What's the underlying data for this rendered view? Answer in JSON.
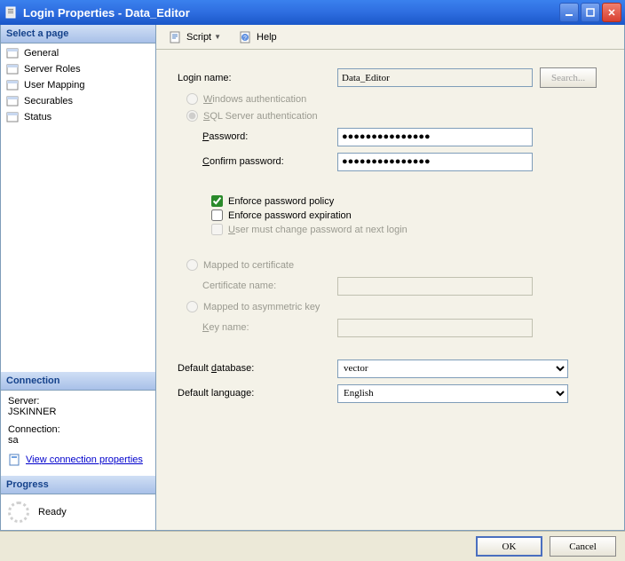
{
  "titlebar": {
    "title": "Login Properties - Data_Editor"
  },
  "sidebar": {
    "select_header": "Select a page",
    "pages": [
      {
        "label": "General"
      },
      {
        "label": "Server Roles"
      },
      {
        "label": "User Mapping"
      },
      {
        "label": "Securables"
      },
      {
        "label": "Status"
      }
    ],
    "connection_header": "Connection",
    "server_label": "Server:",
    "server_value": "JSKINNER",
    "connection_label": "Connection:",
    "connection_value": "sa",
    "view_conn_link": "View connection properties",
    "progress_header": "Progress",
    "progress_status": "Ready"
  },
  "toolbar": {
    "script": "Script",
    "help": "Help"
  },
  "form": {
    "login_name_label": "Login name:",
    "login_name_value": "Data_Editor",
    "search_btn": "Search...",
    "windows_auth": "Windows authentication",
    "sql_auth": "SQL Server authentication",
    "password_label": "Password:",
    "password_value": "●●●●●●●●●●●●●●●",
    "confirm_label": "Confirm password:",
    "confirm_value": "●●●●●●●●●●●●●●●",
    "enforce_policy": "Enforce password policy",
    "enforce_expiration": "Enforce password expiration",
    "must_change": "User must change password at next login",
    "mapped_cert": "Mapped to certificate",
    "cert_name_label": "Certificate name:",
    "mapped_asym": "Mapped to asymmetric key",
    "key_name_label": "Key name:",
    "default_db_label": "Default database:",
    "default_db_value": "vector",
    "default_lang_label": "Default language:",
    "default_lang_value": "English"
  },
  "buttons": {
    "ok": "OK",
    "cancel": "Cancel"
  }
}
